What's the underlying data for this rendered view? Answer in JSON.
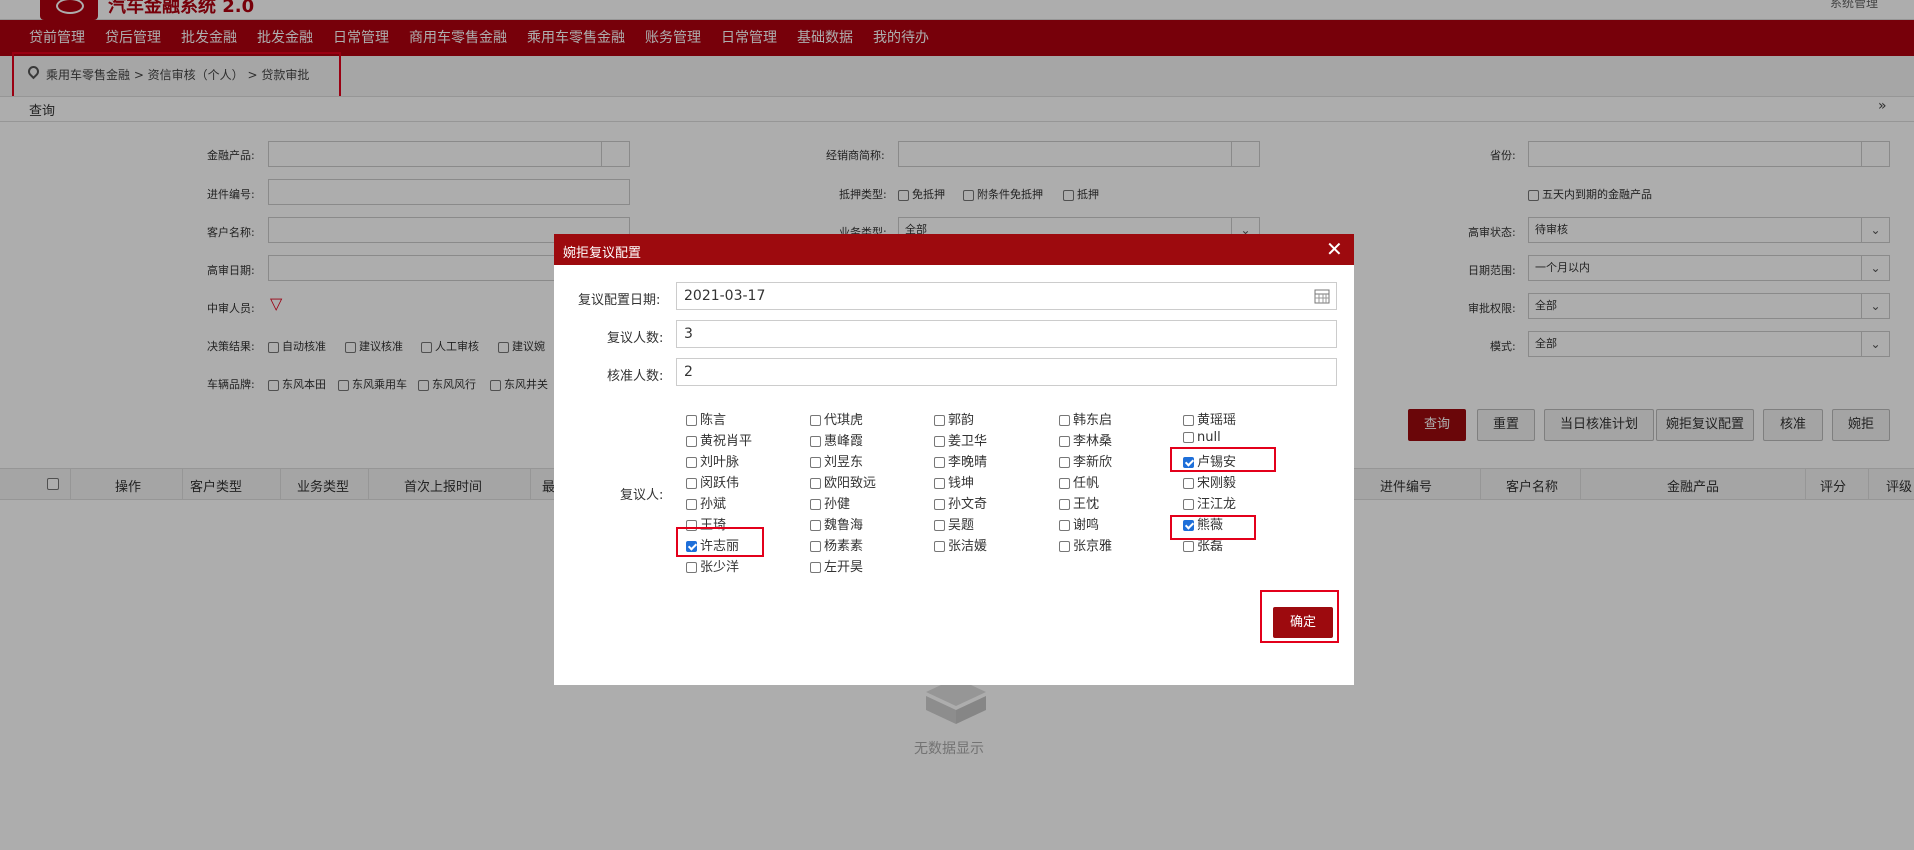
{
  "header": {
    "logo_text": "汽车金融系统 2.0",
    "user_text": "系统管理"
  },
  "nav": [
    "贷前管理",
    "贷后管理",
    "批发金融",
    "批发金融",
    "日常管理",
    "商用车零售金融",
    "乘用车零售金融",
    "账务管理",
    "日常管理",
    "基础数据",
    "我的待办"
  ],
  "breadcrumb": {
    "text": "乘用车零售金融  >  资信审核（个人）  >  贷款审批"
  },
  "panel": {
    "title": "查询",
    "collapse_icon": "double-chevron-down"
  },
  "filters": {
    "product_label": "金融产品:",
    "dealer_label": "经销商简称:",
    "province_label": "省份:",
    "order_no_label": "进件编号:",
    "mortgage_label": "抵押类型:",
    "mortgage_options": [
      "免抵押",
      "附条件免抵押",
      "抵押"
    ],
    "expiring_label": "五天内到期的金融产品",
    "customer_label": "客户名称:",
    "biz_type_label": "业务类型:",
    "biz_type_value": "全部",
    "senior_status_label": "高审状态:",
    "senior_status_value": "待审核",
    "senior_date_label": "高审日期:",
    "date_range_label": "日期范围:",
    "date_range_value": "一个月以内",
    "mid_reviewer_label": "中审人员:",
    "approve_auth_label": "审批权限:",
    "approve_auth_value": "全部",
    "decision_label": "决策结果:",
    "decision_options": [
      "自动核准",
      "建议核准",
      "人工审核",
      "建议婉"
    ],
    "mode_label": "模式:",
    "mode_value": "全部",
    "brand_label": "车辆品牌:",
    "brand_options": [
      "东风本田",
      "东风乘用车",
      "东风风行",
      "东风井关"
    ]
  },
  "actions": [
    "查询",
    "重置",
    "当日核准计划",
    "婉拒复议配置",
    "核准",
    "婉拒"
  ],
  "table": {
    "columns": [
      "操作",
      "客户类型",
      "业务类型",
      "首次上报时间",
      "最",
      "进件编号",
      "客户名称",
      "金融产品",
      "评分",
      "评级"
    ]
  },
  "empty_text": "无数据显示",
  "modal": {
    "title": "婉拒复议配置",
    "date_label": "复议配置日期:",
    "date_value": "2021-03-17",
    "count_label": "复议人数:",
    "count_value": "3",
    "approve_label": "核准人数:",
    "approve_value": "2",
    "reviewer_label": "复议人:",
    "reviewers": [
      [
        {
          "name": "陈言",
          "checked": false
        },
        {
          "name": "黄祝肖平",
          "checked": false
        },
        {
          "name": "刘叶脉",
          "checked": false
        },
        {
          "name": "闵跃伟",
          "checked": false
        },
        {
          "name": "孙斌",
          "checked": false
        },
        {
          "name": "王琦",
          "checked": false
        },
        {
          "name": "许志丽",
          "checked": true
        },
        {
          "name": "张少洋",
          "checked": false
        }
      ],
      [
        {
          "name": "代琪虎",
          "checked": false
        },
        {
          "name": "惠峰霞",
          "checked": false
        },
        {
          "name": "刘昱东",
          "checked": false
        },
        {
          "name": "欧阳致远",
          "checked": false
        },
        {
          "name": "孙健",
          "checked": false
        },
        {
          "name": "魏鲁海",
          "checked": false
        },
        {
          "name": "杨素素",
          "checked": false
        },
        {
          "name": "左开昊",
          "checked": false
        }
      ],
      [
        {
          "name": "郭韵",
          "checked": false
        },
        {
          "name": "姜卫华",
          "checked": false
        },
        {
          "name": "李晚晴",
          "checked": false
        },
        {
          "name": "钱坤",
          "checked": false
        },
        {
          "name": "孙文奇",
          "checked": false
        },
        {
          "name": "吴题",
          "checked": false
        },
        {
          "name": "张洁媛",
          "checked": false
        }
      ],
      [
        {
          "name": "韩东启",
          "checked": false
        },
        {
          "name": "李林桑",
          "checked": false
        },
        {
          "name": "李新欣",
          "checked": false
        },
        {
          "name": "任帆",
          "checked": false
        },
        {
          "name": "王忱",
          "checked": false
        },
        {
          "name": "谢鸣",
          "checked": false
        },
        {
          "name": "张京雅",
          "checked": false
        }
      ],
      [
        {
          "name": "黄瑶瑶",
          "checked": false
        },
        {
          "name": "null",
          "checked": false
        },
        {
          "name": "卢锡安",
          "checked": true
        },
        {
          "name": "宋刚毅",
          "checked": false
        },
        {
          "name": "汪江龙",
          "checked": false
        },
        {
          "name": "熊薇",
          "checked": true
        },
        {
          "name": "张磊",
          "checked": false
        }
      ]
    ],
    "confirm_label": "确定"
  },
  "colors": {
    "brand": "#b0000f",
    "button_primary": "#9d0a0e",
    "highlight": "#e3001b",
    "check": "#1e6fd9"
  }
}
